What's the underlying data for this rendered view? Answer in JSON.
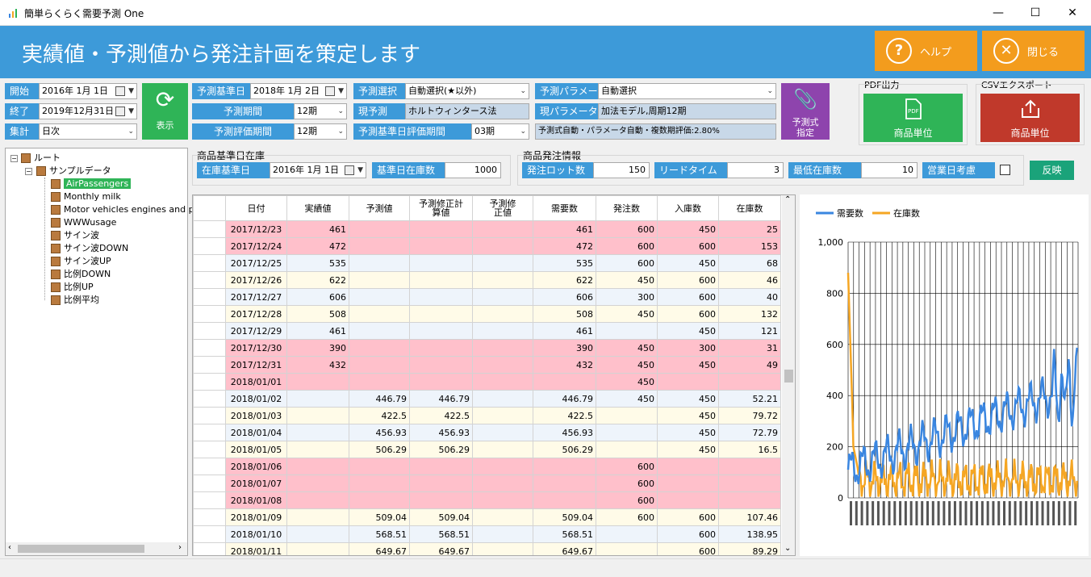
{
  "window": {
    "title": "簡単らくらく需要予測 One",
    "minimize": "—",
    "maximize": "☐",
    "close": "✕"
  },
  "header": {
    "title": "実績値・予測値から発注計画を策定します",
    "help_label": "ヘルプ",
    "close_label": "閉じる",
    "help_icon": "?",
    "close_icon": "✕"
  },
  "form": {
    "start_label": "開始",
    "start_value": "2016年 1月 1日",
    "end_label": "終了",
    "end_value": "2019年12月31日",
    "agg_label": "集計",
    "agg_value": "日次",
    "show_label": "表示",
    "base_date_label": "予測基準日",
    "base_date_value": "2018年 1月 2日",
    "period_label": "予測期間",
    "period_value": "12期",
    "eval_period_label": "予測評価期間",
    "eval_period_value": "12期",
    "select_label": "予測選択",
    "select_value": "自動選択(★以外)",
    "current_label": "現予測",
    "current_value": "ホルトウィンタース法",
    "base_eval_label": "予測基準日評価期間",
    "base_eval_value": "03期",
    "param_label": "予測パラメータ",
    "param_value": "自動選択",
    "cur_param_label": "現パラメータ",
    "cur_param_value": "加法モデル,周期12期",
    "formula_info": "予測式自動・パラメータ自動・複数期評価:2.80%",
    "formula_btn": "予測式\n指定",
    "pdf_title": "PDF出力",
    "pdf_btn": "商品単位",
    "csv_title": "CSVエクスポート",
    "csv_btn": "商品単位"
  },
  "stock": {
    "group_title": "商品基準日在庫",
    "date_label": "在庫基準日",
    "date_value": "2016年 1月 1日",
    "qty_label": "基準日在庫数",
    "qty_value": "1000"
  },
  "order": {
    "group_title": "商品発注情報",
    "lot_label": "発注ロット数",
    "lot_value": "150",
    "lead_label": "リードタイム",
    "lead_value": "3",
    "min_label": "最低在庫数",
    "min_value": "10",
    "bizday_label": "営業日考慮",
    "apply_label": "反映"
  },
  "tree": {
    "root": "ルート",
    "sample": "サンプルデータ",
    "items": [
      "AirPassengers",
      "Monthly milk",
      "Motor vehicles engines and p",
      "WWWusage",
      "サイン波",
      "サイン波DOWN",
      "サイン波UP",
      "比例DOWN",
      "比例UP",
      "比例平均"
    ]
  },
  "grid": {
    "headers": [
      "",
      "日付",
      "実績値",
      "予測値",
      "予測修正計\n算値",
      "予測修\n正値",
      "需要数",
      "発注数",
      "入庫数",
      "在庫数"
    ],
    "rows": [
      {
        "s": "pink",
        "v": [
          "2017/12/23",
          "461",
          "",
          "",
          "",
          "461",
          "600",
          "450",
          "25"
        ]
      },
      {
        "s": "pink",
        "v": [
          "2017/12/24",
          "472",
          "",
          "",
          "",
          "472",
          "600",
          "600",
          "153"
        ]
      },
      {
        "s": "blue",
        "v": [
          "2017/12/25",
          "535",
          "",
          "",
          "",
          "535",
          "600",
          "450",
          "68"
        ]
      },
      {
        "s": "yel",
        "v": [
          "2017/12/26",
          "622",
          "",
          "",
          "",
          "622",
          "450",
          "600",
          "46"
        ]
      },
      {
        "s": "blue",
        "v": [
          "2017/12/27",
          "606",
          "",
          "",
          "",
          "606",
          "300",
          "600",
          "40"
        ]
      },
      {
        "s": "yel",
        "v": [
          "2017/12/28",
          "508",
          "",
          "",
          "",
          "508",
          "450",
          "600",
          "132"
        ]
      },
      {
        "s": "blue",
        "v": [
          "2017/12/29",
          "461",
          "",
          "",
          "",
          "461",
          "",
          "450",
          "121"
        ]
      },
      {
        "s": "pink",
        "v": [
          "2017/12/30",
          "390",
          "",
          "",
          "",
          "390",
          "450",
          "300",
          "31"
        ]
      },
      {
        "s": "pink",
        "v": [
          "2017/12/31",
          "432",
          "",
          "",
          "",
          "432",
          "450",
          "450",
          "49"
        ]
      },
      {
        "s": "pink",
        "v": [
          "2018/01/01",
          "",
          "",
          "",
          "",
          "",
          "450",
          "",
          ""
        ]
      },
      {
        "s": "blue",
        "v": [
          "2018/01/02",
          "",
          "446.79",
          "446.79",
          "",
          "446.79",
          "450",
          "450",
          "52.21"
        ]
      },
      {
        "s": "yel",
        "v": [
          "2018/01/03",
          "",
          "422.5",
          "422.5",
          "",
          "422.5",
          "",
          "450",
          "79.72"
        ]
      },
      {
        "s": "blue",
        "v": [
          "2018/01/04",
          "",
          "456.93",
          "456.93",
          "",
          "456.93",
          "",
          "450",
          "72.79"
        ]
      },
      {
        "s": "yel",
        "v": [
          "2018/01/05",
          "",
          "506.29",
          "506.29",
          "",
          "506.29",
          "",
          "450",
          "16.5"
        ]
      },
      {
        "s": "pink",
        "v": [
          "2018/01/06",
          "",
          "",
          "",
          "",
          "",
          "600",
          "",
          ""
        ]
      },
      {
        "s": "pink",
        "v": [
          "2018/01/07",
          "",
          "",
          "",
          "",
          "",
          "600",
          "",
          ""
        ]
      },
      {
        "s": "pink",
        "v": [
          "2018/01/08",
          "",
          "",
          "",
          "",
          "",
          "600",
          "",
          ""
        ]
      },
      {
        "s": "yel",
        "v": [
          "2018/01/09",
          "",
          "509.04",
          "509.04",
          "",
          "509.04",
          "600",
          "600",
          "107.46"
        ]
      },
      {
        "s": "blue",
        "v": [
          "2018/01/10",
          "",
          "568.51",
          "568.51",
          "",
          "568.51",
          "",
          "600",
          "138.95"
        ]
      },
      {
        "s": "yel",
        "v": [
          "2018/01/11",
          "",
          "649.67",
          "649.67",
          "",
          "649.67",
          "",
          "600",
          "89.29"
        ]
      }
    ]
  },
  "chart_data": {
    "type": "line",
    "series": [
      {
        "name": "需要数",
        "color": "#3a86e0"
      },
      {
        "name": "在庫数",
        "color": "#f5a623"
      }
    ],
    "ylim": [
      0,
      1000
    ],
    "yticks": [
      "1,000",
      "800",
      "600",
      "400",
      "200",
      "0"
    ]
  }
}
